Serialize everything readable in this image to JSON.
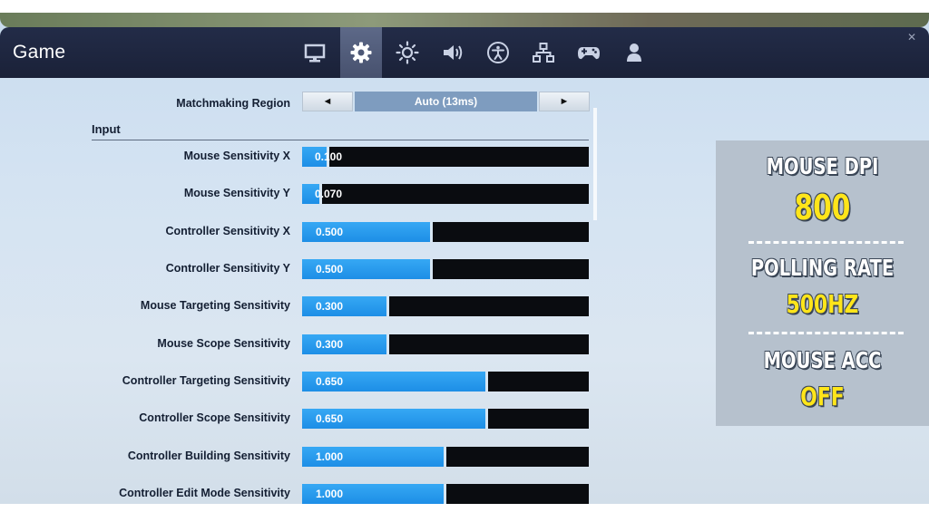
{
  "header": {
    "title": "Game",
    "tabs": [
      {
        "icon": "monitor-icon",
        "active": false
      },
      {
        "icon": "gear-icon",
        "active": true
      },
      {
        "icon": "brightness-icon",
        "active": false
      },
      {
        "icon": "speaker-icon",
        "active": false
      },
      {
        "icon": "accessibility-icon",
        "active": false
      },
      {
        "icon": "network-icon",
        "active": false
      },
      {
        "icon": "controller-icon",
        "active": false
      },
      {
        "icon": "account-icon",
        "active": false
      }
    ]
  },
  "matchmaking": {
    "label": "Matchmaking Region",
    "value": "Auto (13ms)",
    "prev_icon": "◄",
    "next_icon": "►"
  },
  "section": {
    "title": "Input"
  },
  "sliders": [
    {
      "label": "Mouse Sensitivity X",
      "value": "0.100",
      "fill": 0.085
    },
    {
      "label": "Mouse Sensitivity Y",
      "value": "0.070",
      "fill": 0.06
    },
    {
      "label": "Controller Sensitivity X",
      "value": "0.500",
      "fill": 0.445
    },
    {
      "label": "Controller Sensitivity Y",
      "value": "0.500",
      "fill": 0.445
    },
    {
      "label": "Mouse Targeting Sensitivity",
      "value": "0.300",
      "fill": 0.295
    },
    {
      "label": "Mouse Scope Sensitivity",
      "value": "0.300",
      "fill": 0.295
    },
    {
      "label": "Controller Targeting Sensitivity",
      "value": "0.650",
      "fill": 0.64
    },
    {
      "label": "Controller Scope Sensitivity",
      "value": "0.650",
      "fill": 0.64
    },
    {
      "label": "Controller Building Sensitivity",
      "value": "1.000",
      "fill": 0.495
    },
    {
      "label": "Controller Edit Mode Sensitivity",
      "value": "1.000",
      "fill": 0.495
    }
  ],
  "info_card": {
    "items": [
      {
        "heading": "MOUSE DPI",
        "value": "800"
      },
      {
        "heading": "POLLING RATE",
        "value": "500HZ"
      },
      {
        "heading": "MOUSE ACC",
        "value": "OFF"
      }
    ]
  },
  "colors": {
    "navbar": "#1f2740",
    "slider_fill": "#2a9cf0",
    "slider_track": "#0a0c10",
    "card_value": "#ffe51a"
  }
}
